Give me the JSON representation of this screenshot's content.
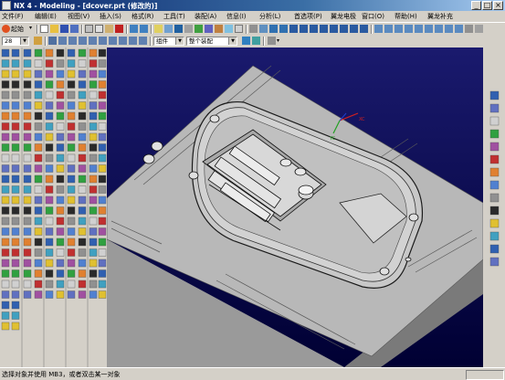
{
  "window": {
    "title": "NX 4 - Modeling - [dcover.prt (修改的)]"
  },
  "menu": {
    "items": [
      {
        "label": "文件(F)"
      },
      {
        "label": "编辑(E)"
      },
      {
        "label": "视图(V)"
      },
      {
        "label": "插入(S)"
      },
      {
        "label": "格式(R)"
      },
      {
        "label": "工具(T)"
      },
      {
        "label": "装配(A)"
      },
      {
        "label": "信息(I)"
      },
      {
        "label": "分析(L)"
      },
      {
        "label": "首选项(P)"
      },
      {
        "label": "翼龙电极"
      },
      {
        "label": "窗口(O)"
      },
      {
        "label": "帮助(H)"
      },
      {
        "label": "翼龙补充"
      }
    ]
  },
  "toolbar": {
    "start_label": "起始",
    "layer_value": "28",
    "filter_value": "组件",
    "scope_value": "整个装配"
  },
  "viewport": {
    "wcs_x_label": "XC",
    "wcs_y_label": "YC"
  },
  "status": {
    "prompt": "选择对象并使用 MB3，或者双击某一对象"
  },
  "colors": {
    "title_gradient_start": "#0a246a",
    "title_gradient_end": "#a6caf0",
    "viewport_background": "#00004d",
    "model_gray": "#b8b8b8",
    "wcs_x_color": "#d02020",
    "wcs_y_color": "#20a020"
  }
}
